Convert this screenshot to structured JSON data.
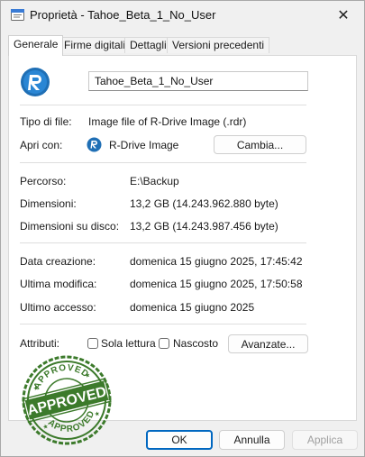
{
  "window": {
    "title": "Proprietà - Tahoe_Beta_1_No_User",
    "icons": {
      "title": "folder-properties-icon",
      "close": "close-icon"
    }
  },
  "tabs": [
    {
      "label": "Generale",
      "active": true
    },
    {
      "label": "Firme digitali",
      "active": false
    },
    {
      "label": "Dettagli",
      "active": false
    },
    {
      "label": "Versioni precedenti",
      "active": false
    }
  ],
  "general": {
    "file_name": "Tahoe_Beta_1_No_User",
    "file_icon": "r-drive-image-icon",
    "type_label": "Tipo di file:",
    "type_value": "Image file of R-Drive Image (.rdr)",
    "opens_label": "Apri con:",
    "opens_value": "R-Drive Image",
    "change_button": "Cambia...",
    "location_label": "Percorso:",
    "location_value": "E:\\Backup",
    "size_label": "Dimensioni:",
    "size_value": "13,2 GB (14.243.962.880 byte)",
    "size_on_disk_label": "Dimensioni su disco:",
    "size_on_disk_value": "13,2 GB (14.243.987.456 byte)",
    "created_label": "Data creazione:",
    "created_value": "domenica 15 giugno 2025, 17:45:42",
    "modified_label": "Ultima modifica:",
    "modified_value": "domenica 15 giugno 2025, 17:50:58",
    "accessed_label": "Ultimo accesso:",
    "accessed_value": "domenica 15 giugno 2025",
    "attributes_label": "Attributi:",
    "readonly_label": "Sola lettura",
    "readonly_checked": false,
    "hidden_label": "Nascosto",
    "hidden_checked": false,
    "advanced_button": "Avanzate..."
  },
  "stamp": {
    "text_top": "APPROVED",
    "text_main": "APPROVED",
    "text_bottom": "APPROVED",
    "color": "#3c7a2b"
  },
  "footer": {
    "ok": "OK",
    "cancel": "Annulla",
    "apply": "Applica",
    "apply_enabled": false
  },
  "colors": {
    "accent": "#0067c0",
    "rdrive_blue": "#1f6fb5",
    "stamp_green": "#3c7a2b"
  }
}
